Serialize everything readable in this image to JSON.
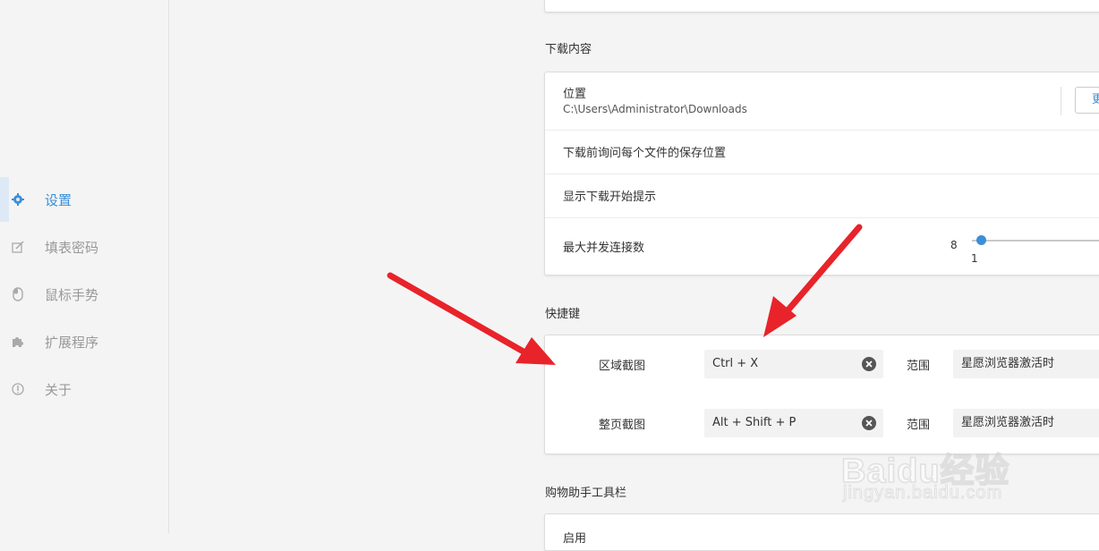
{
  "sidebar": {
    "items": [
      {
        "label": "设置",
        "icon": "gear-icon",
        "active": true
      },
      {
        "label": "填表密码",
        "icon": "form-edit-icon",
        "active": false
      },
      {
        "label": "鼠标手势",
        "icon": "mouse-icon",
        "active": false
      },
      {
        "label": "扩展程序",
        "icon": "puzzle-icon",
        "active": false
      },
      {
        "label": "关于",
        "icon": "info-icon",
        "active": false
      }
    ]
  },
  "downloads": {
    "section_title": "下载内容",
    "location_label": "位置",
    "location_path": "C:\\Users\\Administrator\\Downloads",
    "change_button_label": "更改",
    "ask_each_file_label": "下载前询问每个文件的保存位置",
    "show_start_tip_label": "显示下载开始提示",
    "max_connections_label": "最大并发连接数",
    "max_connections_value": "8",
    "slider_min_label": "1"
  },
  "shortcuts": {
    "section_title": "快捷键",
    "rows": [
      {
        "label": "区域截图",
        "keys": "Ctrl + X",
        "scope_label": "范围",
        "scope_value": "星愿浏览器激活时"
      },
      {
        "label": "整页截图",
        "keys": "Alt + Shift + P",
        "scope_label": "范围",
        "scope_value": "星愿浏览器激活时"
      }
    ]
  },
  "shopping": {
    "section_title": "购物助手工具栏",
    "first_row_label": "启用"
  },
  "watermark": {
    "line1": "Baidu经验",
    "line2": "jingyan.baidu.com"
  },
  "colors": {
    "accent": "#3b8fd8",
    "arrow": "#e8232a",
    "background": "#f4f4f4"
  }
}
